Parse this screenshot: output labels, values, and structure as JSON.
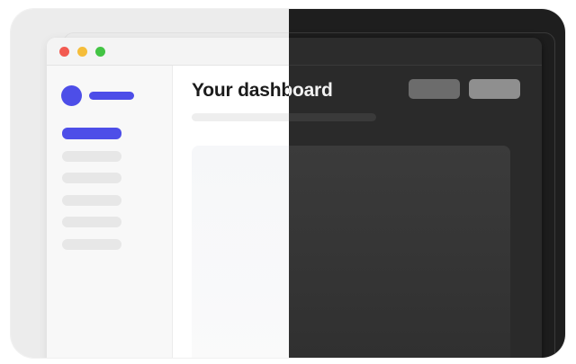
{
  "page_title": "Your dashboard",
  "window_controls": [
    {
      "name": "close",
      "color": "#f25a51"
    },
    {
      "name": "minimize",
      "color": "#f5bd3a"
    },
    {
      "name": "maximize",
      "color": "#43c444"
    }
  ],
  "colors": {
    "accent": "#4d4ee8",
    "light_background": "#ececec",
    "dark_background": "#1e1e1e"
  },
  "sidebar": {
    "active_item_index": 0,
    "item_count": 6
  },
  "header_buttons": [
    {
      "name": "secondary"
    },
    {
      "name": "primary"
    }
  ]
}
